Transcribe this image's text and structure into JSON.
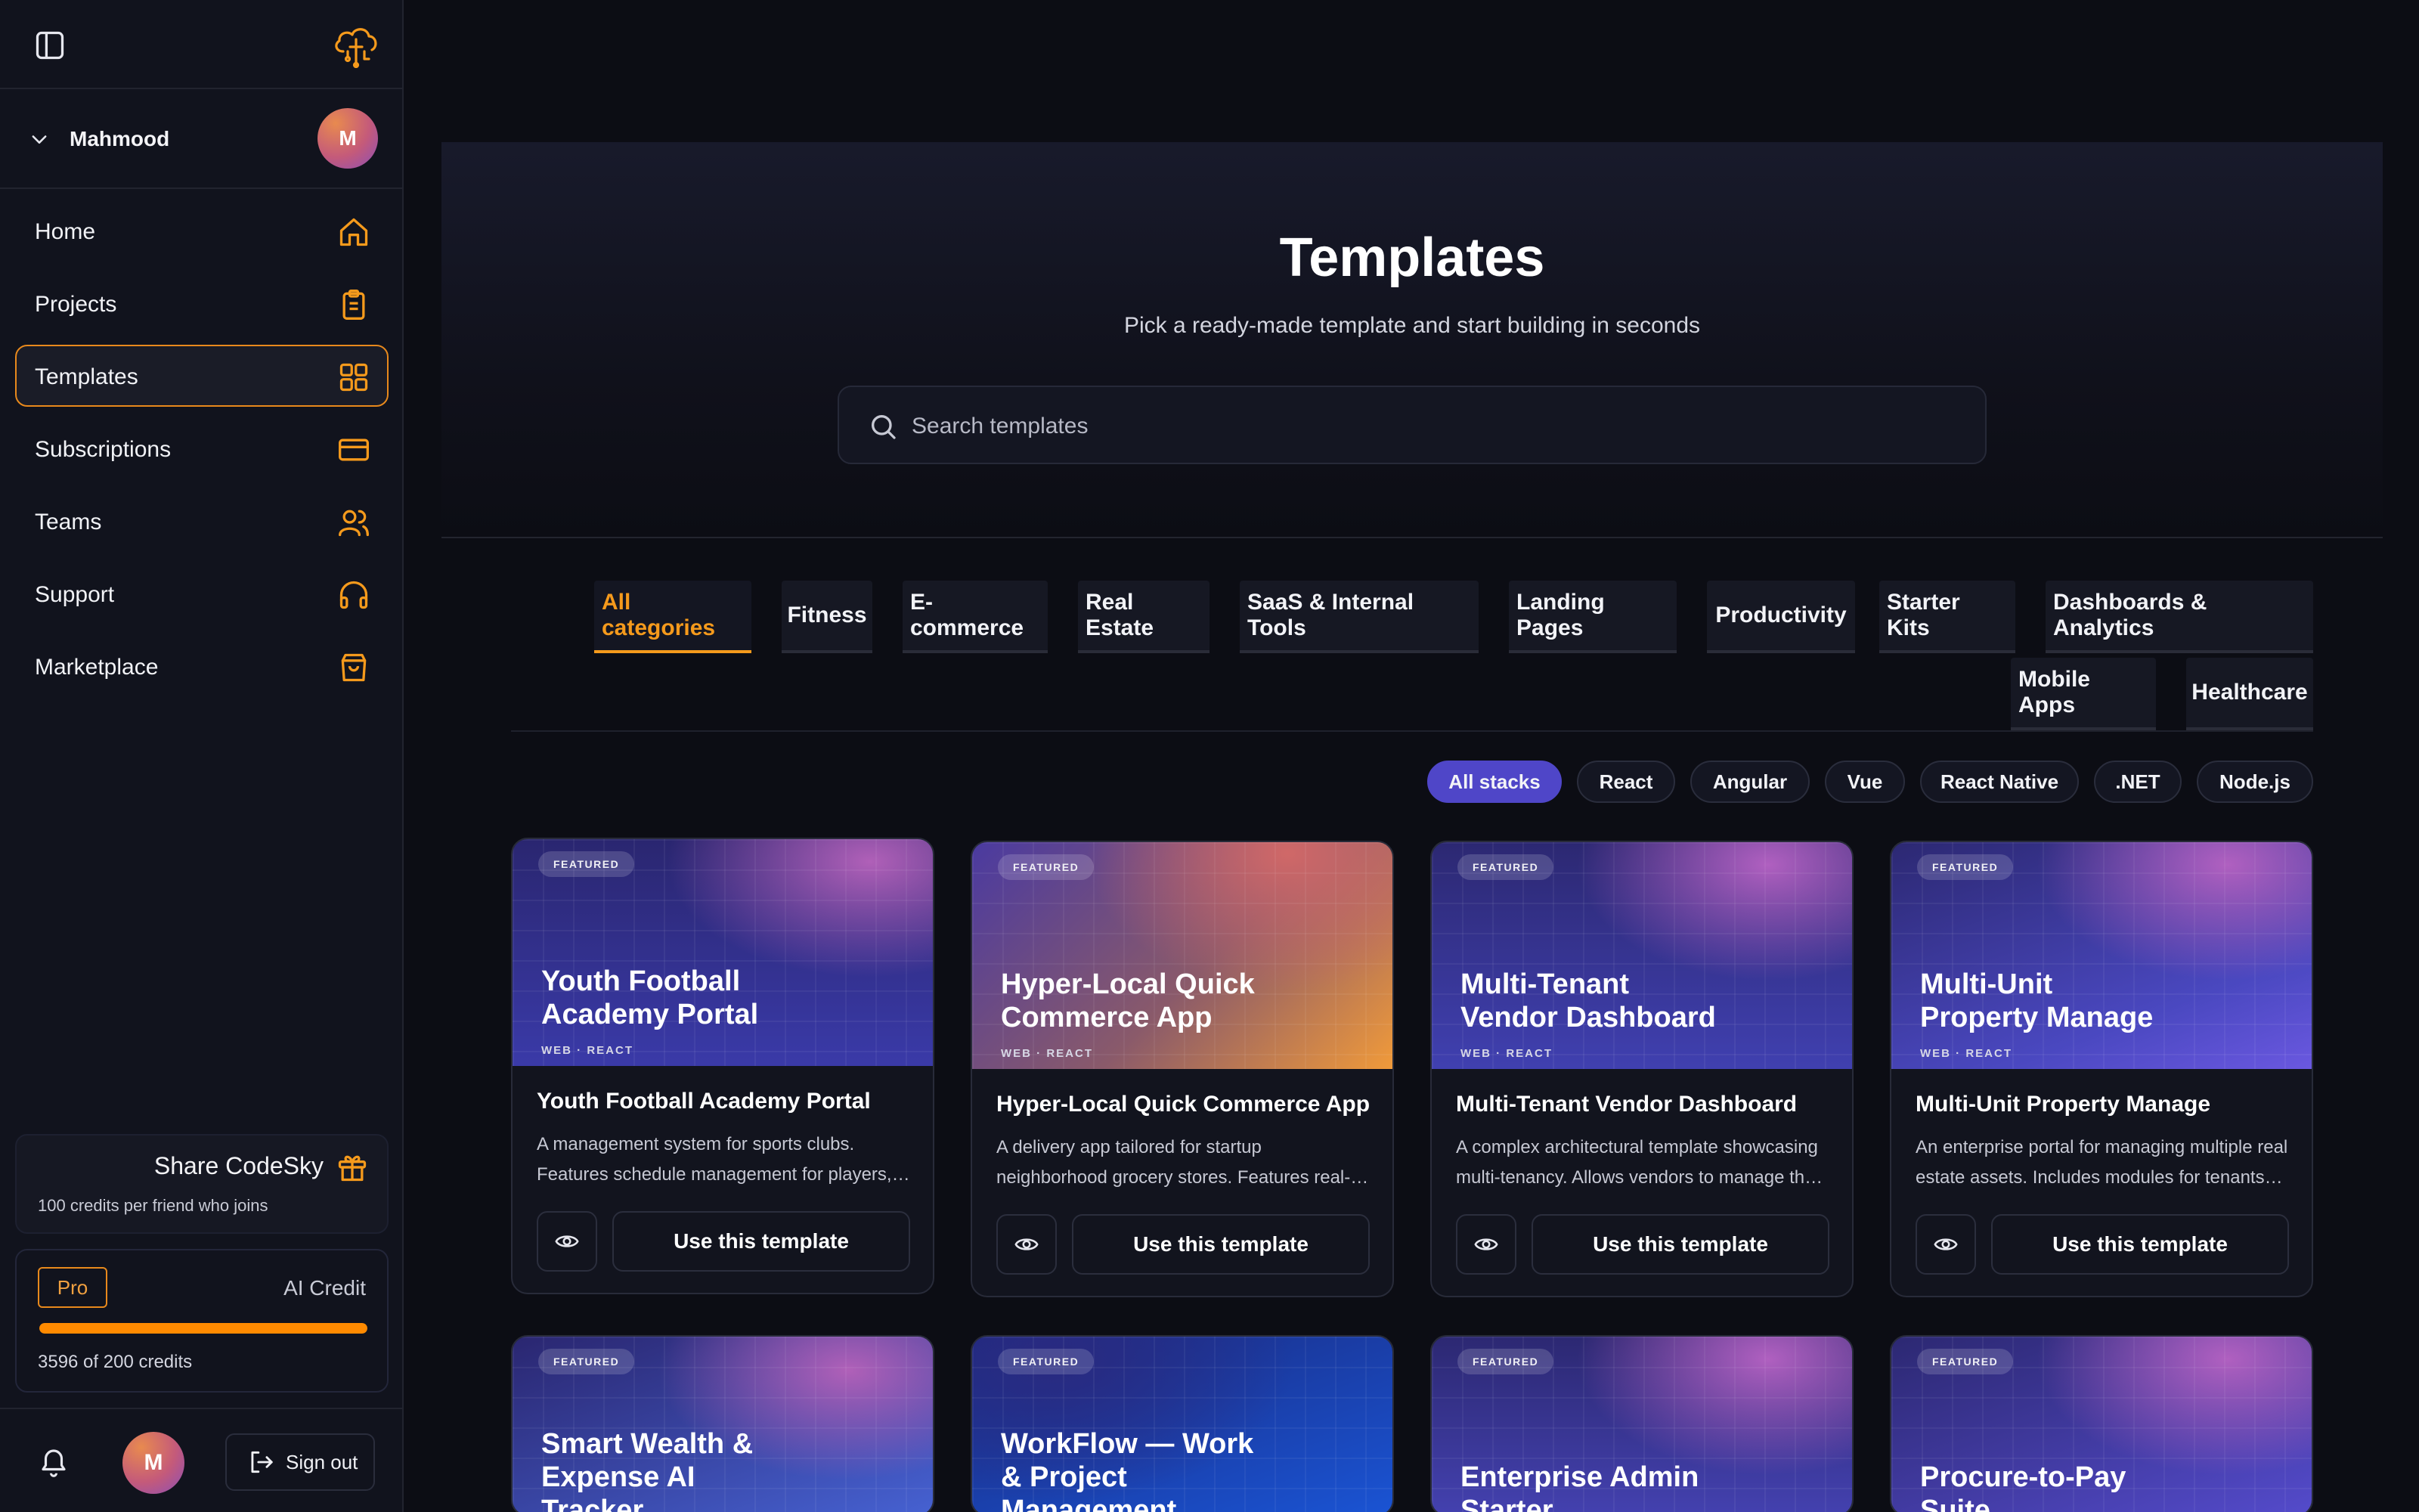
{
  "sidebar": {
    "user_name": "Mahmood",
    "avatar_initial": "M",
    "nav": [
      {
        "label": "Home",
        "icon": "home-icon"
      },
      {
        "label": "Projects",
        "icon": "clipboard-icon"
      },
      {
        "label": "Templates",
        "icon": "grid-icon",
        "active": true
      },
      {
        "label": "Subscriptions",
        "icon": "credit-card-icon"
      },
      {
        "label": "Teams",
        "icon": "users-icon"
      },
      {
        "label": "Support",
        "icon": "headphones-icon"
      },
      {
        "label": "Marketplace",
        "icon": "shopping-bag-icon"
      }
    ],
    "share": {
      "title": "Share CodeSky",
      "subtitle": "100 credits per friend who joins"
    },
    "credits": {
      "plan": "Pro",
      "label": "AI Credit",
      "text": "3596 of 200 credits",
      "progress": 1.0
    },
    "signout_label": "Sign out"
  },
  "hero": {
    "title": "Templates",
    "subtitle": "Pick a ready-made template and start building in seconds",
    "search_placeholder": "Search templates"
  },
  "categories": [
    "All categories",
    "Fitness",
    "E-commerce",
    "Real Estate",
    "SaaS & Internal Tools",
    "Landing Pages",
    "Productivity",
    "Starter Kits",
    "Dashboards & Analytics",
    "Mobile Apps",
    "Healthcare"
  ],
  "active_category": "All categories",
  "stacks": [
    "All stacks",
    "React",
    "Angular",
    "Vue",
    "React Native",
    ".NET",
    "Node.js"
  ],
  "active_stack": "All stacks",
  "cards": [
    {
      "badge": "FEATURED",
      "banner_title": "Youth Football Academy Portal",
      "meta": "WEB · REACT",
      "title": "Youth Football Academy Portal",
      "desc": "A management system for sports clubs. Features schedule management for players, coaches and parents.",
      "eye_icon": "eye-icon",
      "button": "Use this template"
    },
    {
      "badge": "FEATURED",
      "banner_title": "Hyper-Local Quick Commerce App",
      "meta": "WEB · REACT",
      "title": "Hyper-Local Quick Commerce App",
      "desc": "A delivery app tailored for startup neighborhood grocery stores. Features real-time order tracking.",
      "eye_icon": "eye-icon",
      "button": "Use this template"
    },
    {
      "badge": "FEATURED",
      "banner_title": "Multi-Tenant Vendor Dashboard",
      "meta": "WEB · REACT",
      "title": "Multi-Tenant Vendor Dashboard",
      "desc": "A complex architectural template showcasing multi-tenancy. Allows vendors to manage their stores.",
      "eye_icon": "eye-icon",
      "button": "Use this template"
    },
    {
      "badge": "FEATURED",
      "banner_title": "Multi-Unit Property Manage",
      "meta": "WEB · REACT",
      "title": "Multi-Unit Property Manage",
      "desc": "An enterprise portal for managing multiple real estate assets. Includes modules for tenants and leases.",
      "eye_icon": "eye-icon",
      "button": "Use this template"
    },
    {
      "badge": "FEATURED",
      "banner_title": "Smart Wealth & Expense AI Tracker"
    },
    {
      "badge": "FEATURED",
      "banner_title": "WorkFlow — Work & Project Management"
    },
    {
      "badge": "FEATURED",
      "banner_title": "Enterprise Admin Starter"
    },
    {
      "badge": "FEATURED",
      "banner_title": "Procure-to-Pay Suite"
    }
  ],
  "colors": {
    "accent": "#f59a1c",
    "stack_active": "#4f46c8",
    "background": "#0c0d14",
    "sidebar": "#11131d"
  }
}
